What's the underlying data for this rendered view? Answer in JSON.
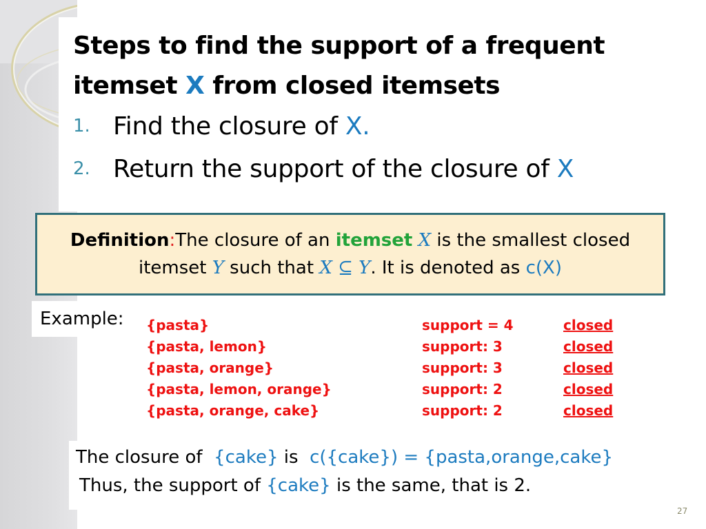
{
  "slide": {
    "title": {
      "line1": "Steps to find the support of a frequent",
      "line2_prefix": "itemset ",
      "line2_var": "X",
      "line2_suffix": " from closed itemsets"
    },
    "steps": [
      {
        "number": "1.",
        "text": "Find the closure of ",
        "var": "X."
      },
      {
        "number": "2.",
        "text": "Return the support of the closure of ",
        "var": "X"
      }
    ],
    "definition": {
      "label": "Definition",
      "colon": ":",
      "text1": "The closure of an ",
      "highlight": "itemset",
      "var_x": "X",
      "text2": " is the smallest closed",
      "text3": "itemset ",
      "var_y": "Y",
      "text4": " such that ",
      "subset_expr": "X ⊆ Y",
      "text5": ". It is denoted as ",
      "notation": "c(X)"
    },
    "example": {
      "label": "Example:",
      "rows": [
        {
          "itemset": "{pasta}",
          "support": "support = 4",
          "status": "closed"
        },
        {
          "itemset": "{pasta, lemon}",
          "support": "support: 3",
          "status": "closed"
        },
        {
          "itemset": "{pasta, orange}",
          "support": "support: 3",
          "status": "closed"
        },
        {
          "itemset": "{pasta, lemon, orange}",
          "support": "support: 2",
          "status": "closed"
        },
        {
          "itemset": "{pasta, orange, cake}",
          "support": "support: 2",
          "status": "closed"
        }
      ]
    },
    "conclusion": {
      "line1_a": "The closure of  ",
      "line1_set": "{cake}",
      "line1_b": " is  ",
      "line1_expr": "c({cake}) = {pasta,orange,cake}",
      "line2_a": "Thus, the support of ",
      "line2_set": "{cake}",
      "line2_b": " is the same, that is 2."
    },
    "page_number": "27",
    "colors": {
      "accent_blue": "#1c7bbf",
      "example_red": "#ee1111",
      "highlight_green": "#22a33a",
      "box_border": "#31707a",
      "box_fill": "#fdefd0"
    }
  }
}
